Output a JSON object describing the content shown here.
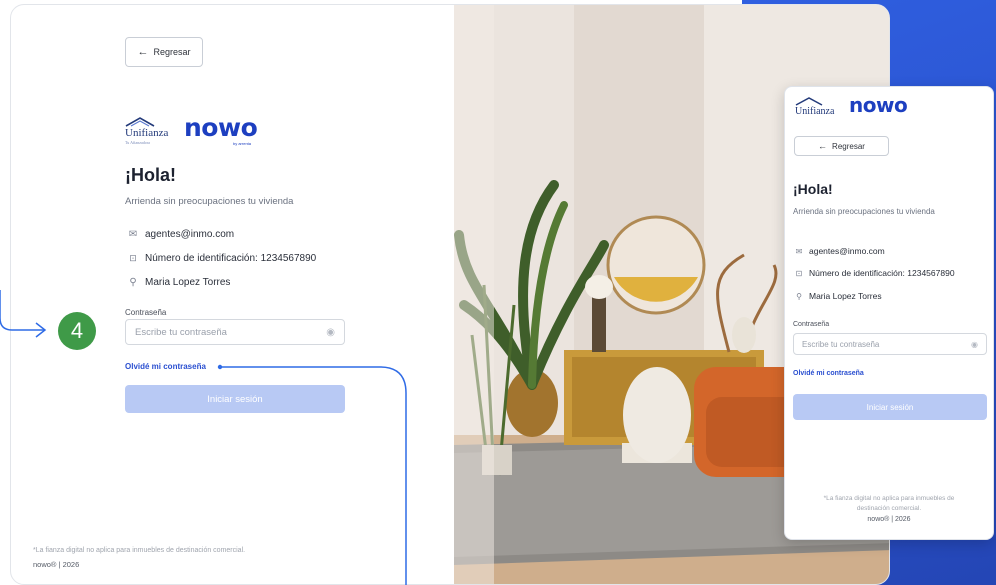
{
  "back_label": "Regresar",
  "brand_left": "Unifianza",
  "brand_left_sub": "Tu Afianzadora",
  "brand_right": "nowo",
  "brand_right_sub": "by arrenta",
  "greeting": "¡Hola!",
  "subtitle": "Arrienda sin preocupaciones tu vivienda",
  "email": "agentes@inmo.com",
  "id_text": "Número de identificación: 1234567890",
  "name": "Maria Lopez Torres",
  "password_label": "Contraseña",
  "password_placeholder": "Escribe tu contraseña",
  "forgot_label": "Olvidé mi contraseña",
  "submit_label": "Iniciar sesión",
  "footnote": "*La fianza digital no aplica para inmuebles de destinación comercial.",
  "footnote_mobile_1": "*La fianza digital no aplica para inmuebles de",
  "footnote_mobile_2": "destinación comercial.",
  "copyright": "nowo® | 2026",
  "step_number": "4",
  "icons": {
    "back": "arrow-left-icon",
    "email": "mail-icon",
    "id": "id-card-icon",
    "user": "user-icon",
    "eye": "eye-icon"
  },
  "colors": {
    "accent": "#2a4fd0",
    "submit_disabled": "#b8c9f4",
    "step_badge": "#3f9a48",
    "annotation": "#2f6be6",
    "side_panel": "#2f5fe0"
  }
}
